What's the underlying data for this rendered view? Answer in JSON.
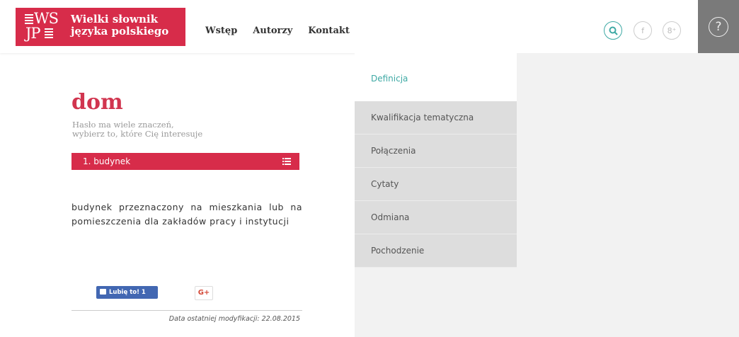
{
  "logo": {
    "mark_top": "WS",
    "mark_bottom": "JP",
    "title_line1": "Wielki słownik",
    "title_line2": "języka polskiego"
  },
  "nav": {
    "items": [
      "Wstęp",
      "Autorzy",
      "Kontakt"
    ]
  },
  "header_icons": {
    "search": "Q",
    "facebook": "f",
    "googleplus": "8⁺",
    "help": "?"
  },
  "entry": {
    "word": "dom",
    "hint_line1": "Hasło ma wiele znaczeń,",
    "hint_line2": "wybierz to, które Cię interesuje",
    "selected_meaning": "1. budynek",
    "definition": "budynek przeznaczony na mieszkania lub na pomieszczenia dla zakładów pracy i instytucji"
  },
  "social": {
    "like_label": "Lubię to! 1",
    "gplus_label": "G+"
  },
  "footer": {
    "modified": "Data ostatniej modyfikacji: 22.08.2015"
  },
  "sidebar": {
    "active": "Definicja",
    "items": [
      "Kwalifikacja tematyczna",
      "Połączenia",
      "Cytaty",
      "Odmiana",
      "Pochodzenie"
    ]
  },
  "colors": {
    "brand": "#d72c4a",
    "accent": "#3ea9a4",
    "facebook": "#4267b2"
  }
}
